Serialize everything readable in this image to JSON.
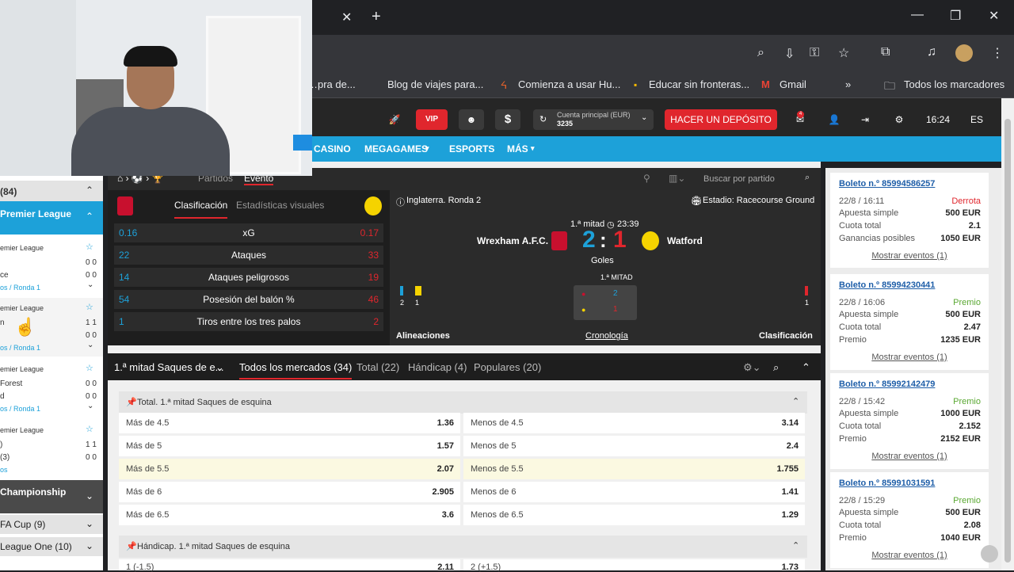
{
  "browser": {
    "bookmarks": [
      "…pra de...",
      "Blog de viajes para...",
      "Comienza a usar Hu...",
      "Educar sin fronteras...",
      "Gmail",
      "»",
      "Todos los marcadores"
    ],
    "close_tab": "✕",
    "new_tab": "+"
  },
  "header": {
    "vip_label": "VIP",
    "account_label": "Cuenta principal (EUR)",
    "account_balance": "3235",
    "deposit_label": "HACER UN DEPÓSITO",
    "time": "16:24",
    "lang": "ES",
    "notif_count": "4"
  },
  "nav": {
    "items": [
      "CASINO",
      "MEGAGAMES",
      "ESPORTS",
      "MÁS"
    ]
  },
  "sidebar": {
    "count_header": "(84)",
    "league_header": "Premier League",
    "matches": [
      {
        "league": "emier League",
        "team1": "",
        "team2": "ce",
        "s1": "0 0",
        "s2": "0 0",
        "link": "os / Ronda 1"
      },
      {
        "league": "emier League",
        "team1": "n",
        "team2": "",
        "s1": "1 1",
        "s2": "0 0",
        "link": "os / Ronda 1"
      },
      {
        "league": "emier League",
        "team1": "Forest",
        "team2": "d",
        "s1": "0 0",
        "s2": "0 0",
        "link": "os / Ronda 1"
      },
      {
        "league": "emier League",
        "team1": ")",
        "team2": " (3)",
        "s1": "1 1",
        "s2": "0 0",
        "link": "os"
      }
    ],
    "other_leagues": [
      "Championship",
      "FA Cup (9)",
      "League One (10)"
    ]
  },
  "event_bar": {
    "tab_matches": "Partidos",
    "tab_event": "Evento",
    "search_placeholder": "Buscar por partido"
  },
  "stats": {
    "tab_class": "Clasificación",
    "tab_visual": "Estadísticas visuales",
    "rows": [
      {
        "l": "0.16",
        "name": "xG",
        "r": "0.17"
      },
      {
        "l": "22",
        "name": "Ataques",
        "r": "33"
      },
      {
        "l": "14",
        "name": "Ataques peligrosos",
        "r": "19"
      },
      {
        "l": "54",
        "name": "Posesión del balón %",
        "r": "46"
      },
      {
        "l": "1",
        "name": "Tiros entre los tres palos",
        "r": "2"
      }
    ]
  },
  "scoreboard": {
    "competition": "Inglaterra. Ronda 2",
    "stadium": "Estadio: Racecourse Ground",
    "period": "1.ª mitad",
    "clock": "23:39",
    "home": "Wrexham A.F.C.",
    "away": "Watford",
    "home_score": "2",
    "away_score": "1",
    "goals_label": "Goles",
    "half_label": "1.ª MITAD",
    "home_flags": "2",
    "home_cards": "1",
    "away_flags": "1",
    "home_half": "2",
    "away_half": "1",
    "lineups": "Alineaciones",
    "timeline": "Cronología",
    "standings": "Clasificación"
  },
  "markets_bar": {
    "selector": "1.ª mitad Saques de e...",
    "tabs": [
      "Todos los mercados (34)",
      "Total (22)",
      "Hándicap (4)",
      "Populares (20)"
    ]
  },
  "markets": {
    "section1": "Total. 1.ª mitad Saques de esquina",
    "rows": [
      {
        "l1": "Más de 4.5",
        "v1": "1.36",
        "l2": "Menos de 4.5",
        "v2": "3.14",
        "hl": false
      },
      {
        "l1": "Más de 5",
        "v1": "1.57",
        "l2": "Menos de 5",
        "v2": "2.4",
        "hl": false
      },
      {
        "l1": "Más de 5.5",
        "v1": "2.07",
        "l2": "Menos de 5.5",
        "v2": "1.755",
        "hl": true
      },
      {
        "l1": "Más de 6",
        "v1": "2.905",
        "l2": "Menos de 6",
        "v2": "1.41",
        "hl": false
      },
      {
        "l1": "Más de 6.5",
        "v1": "3.6",
        "l2": "Menos de 6.5",
        "v2": "1.29",
        "hl": false
      }
    ],
    "section2": "Hándicap. 1.ª mitad Saques de esquina",
    "section2_row": {
      "l1": "1 (-1.5)",
      "v1": "2.11",
      "l2": "2 (+1.5)",
      "v2": "1.73"
    }
  },
  "tickets": [
    {
      "id": "Boleto n.º 85994586257",
      "date": "22/8 / 16:11",
      "status": "Derrota",
      "status_color": "#e0262d",
      "type_k": "Apuesta simple",
      "type_v": "500 EUR",
      "odds_k": "Cuota total",
      "odds_v": "2.1",
      "win_k": "Ganancias posibles",
      "win_v": "1050 EUR",
      "show": "Mostrar eventos (1)"
    },
    {
      "id": "Boleto n.º 85994230441",
      "date": "22/8 / 16:06",
      "status": "Premio",
      "status_color": "#5aa832",
      "type_k": "Apuesta simple",
      "type_v": "500 EUR",
      "odds_k": "Cuota total",
      "odds_v": "2.47",
      "win_k": "Premio",
      "win_v": "1235 EUR",
      "show": "Mostrar eventos (1)"
    },
    {
      "id": "Boleto n.º 85992142479",
      "date": "22/8 / 15:42",
      "status": "Premio",
      "status_color": "#5aa832",
      "type_k": "Apuesta simple",
      "type_v": "1000 EUR",
      "odds_k": "Cuota total",
      "odds_v": "2.152",
      "win_k": "Premio",
      "win_v": "2152 EUR",
      "show": "Mostrar eventos (1)"
    },
    {
      "id": "Boleto n.º 85991031591",
      "date": "22/8 / 15:29",
      "status": "Premio",
      "status_color": "#5aa832",
      "type_k": "Apuesta simple",
      "type_v": "500 EUR",
      "odds_k": "Cuota total",
      "odds_v": "2.08",
      "win_k": "Premio",
      "win_v": "1040 EUR",
      "show": "Mostrar eventos (1)"
    }
  ]
}
